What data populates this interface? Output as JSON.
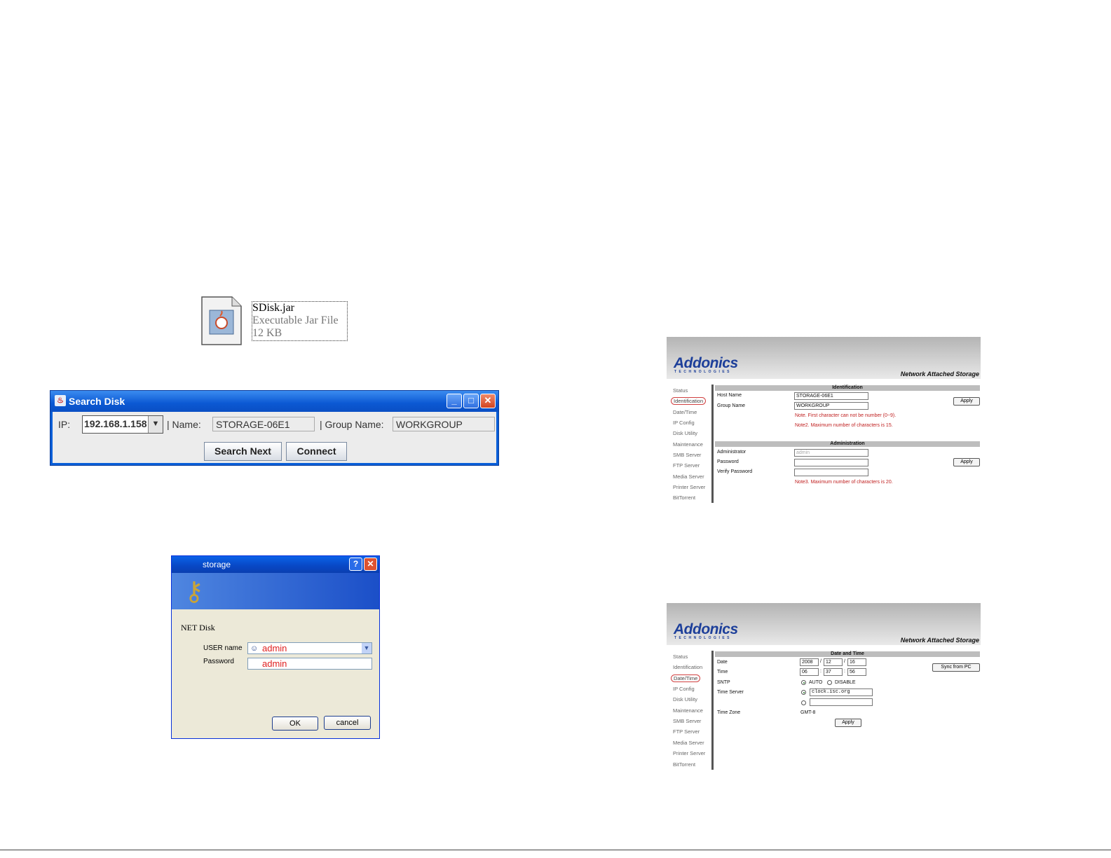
{
  "jar_file": {
    "name": "SDisk.jar",
    "type": "Executable Jar File",
    "size": "12 KB"
  },
  "search_disk": {
    "title": "Search Disk",
    "ip_label": "IP:",
    "ip_value": "192.168.1.158",
    "name_label": "| Name:",
    "name_value": "STORAGE-06E1",
    "group_label": "| Group Name:",
    "group_value": "WORKGROUP",
    "search_next": "Search Next",
    "connect": "Connect"
  },
  "login_dialog": {
    "title": "storage",
    "prompt": "NET Disk",
    "user_label": "USER name",
    "user_value": "admin",
    "password_label": "Password",
    "password_value": "admin",
    "ok": "OK",
    "cancel": "cancel"
  },
  "addonics": {
    "logo": "Addonics",
    "logo_sub": "TECHNOLOGIES",
    "tagline": "Network Attached Storage",
    "nav": [
      "Status",
      "Identification",
      "Date/Time",
      "IP Config",
      "Disk Utility",
      "Maintenance",
      "SMB Server",
      "FTP Server",
      "Media Server",
      "Printer Server",
      "BitTorrent"
    ]
  },
  "identification_page": {
    "section_identification": "Identification",
    "host_name_label": "Host Name",
    "host_name_value": "STORAGE-06E1",
    "group_name_label": "Group Name",
    "group_name_value": "WORKGROUP",
    "note1": "Note. First character can not be number (0~9).",
    "note2": "Note2. Maximum number of characters is 15.",
    "apply": "Apply",
    "section_administration": "Administration",
    "admin_label": "Administrator",
    "admin_value": "admin",
    "password_label": "Password",
    "verify_label": "Verify Password",
    "note3": "Note3. Maximum number of characters is 20."
  },
  "datetime_page": {
    "section": "Date and Time",
    "date_label": "Date",
    "date_year": "2008",
    "date_month": "12",
    "date_day": "16",
    "time_label": "Time",
    "time_h": "06",
    "time_m": "37",
    "time_s": "56",
    "sntp_label": "SNTP",
    "auto": "AUTO",
    "disable": "DISABLE",
    "time_server_label": "Time Server",
    "time_server_value": "clock.isc.org",
    "time_zone_label": "Time Zone",
    "time_zone_value": "GMT-8",
    "apply": "Apply",
    "sync": "Sync from PC"
  },
  "colors": {
    "xp_blue": "#0a5fd8",
    "nav_highlight": "#d04040",
    "note_red": "#c02020",
    "brand": "#1d3f9a"
  }
}
